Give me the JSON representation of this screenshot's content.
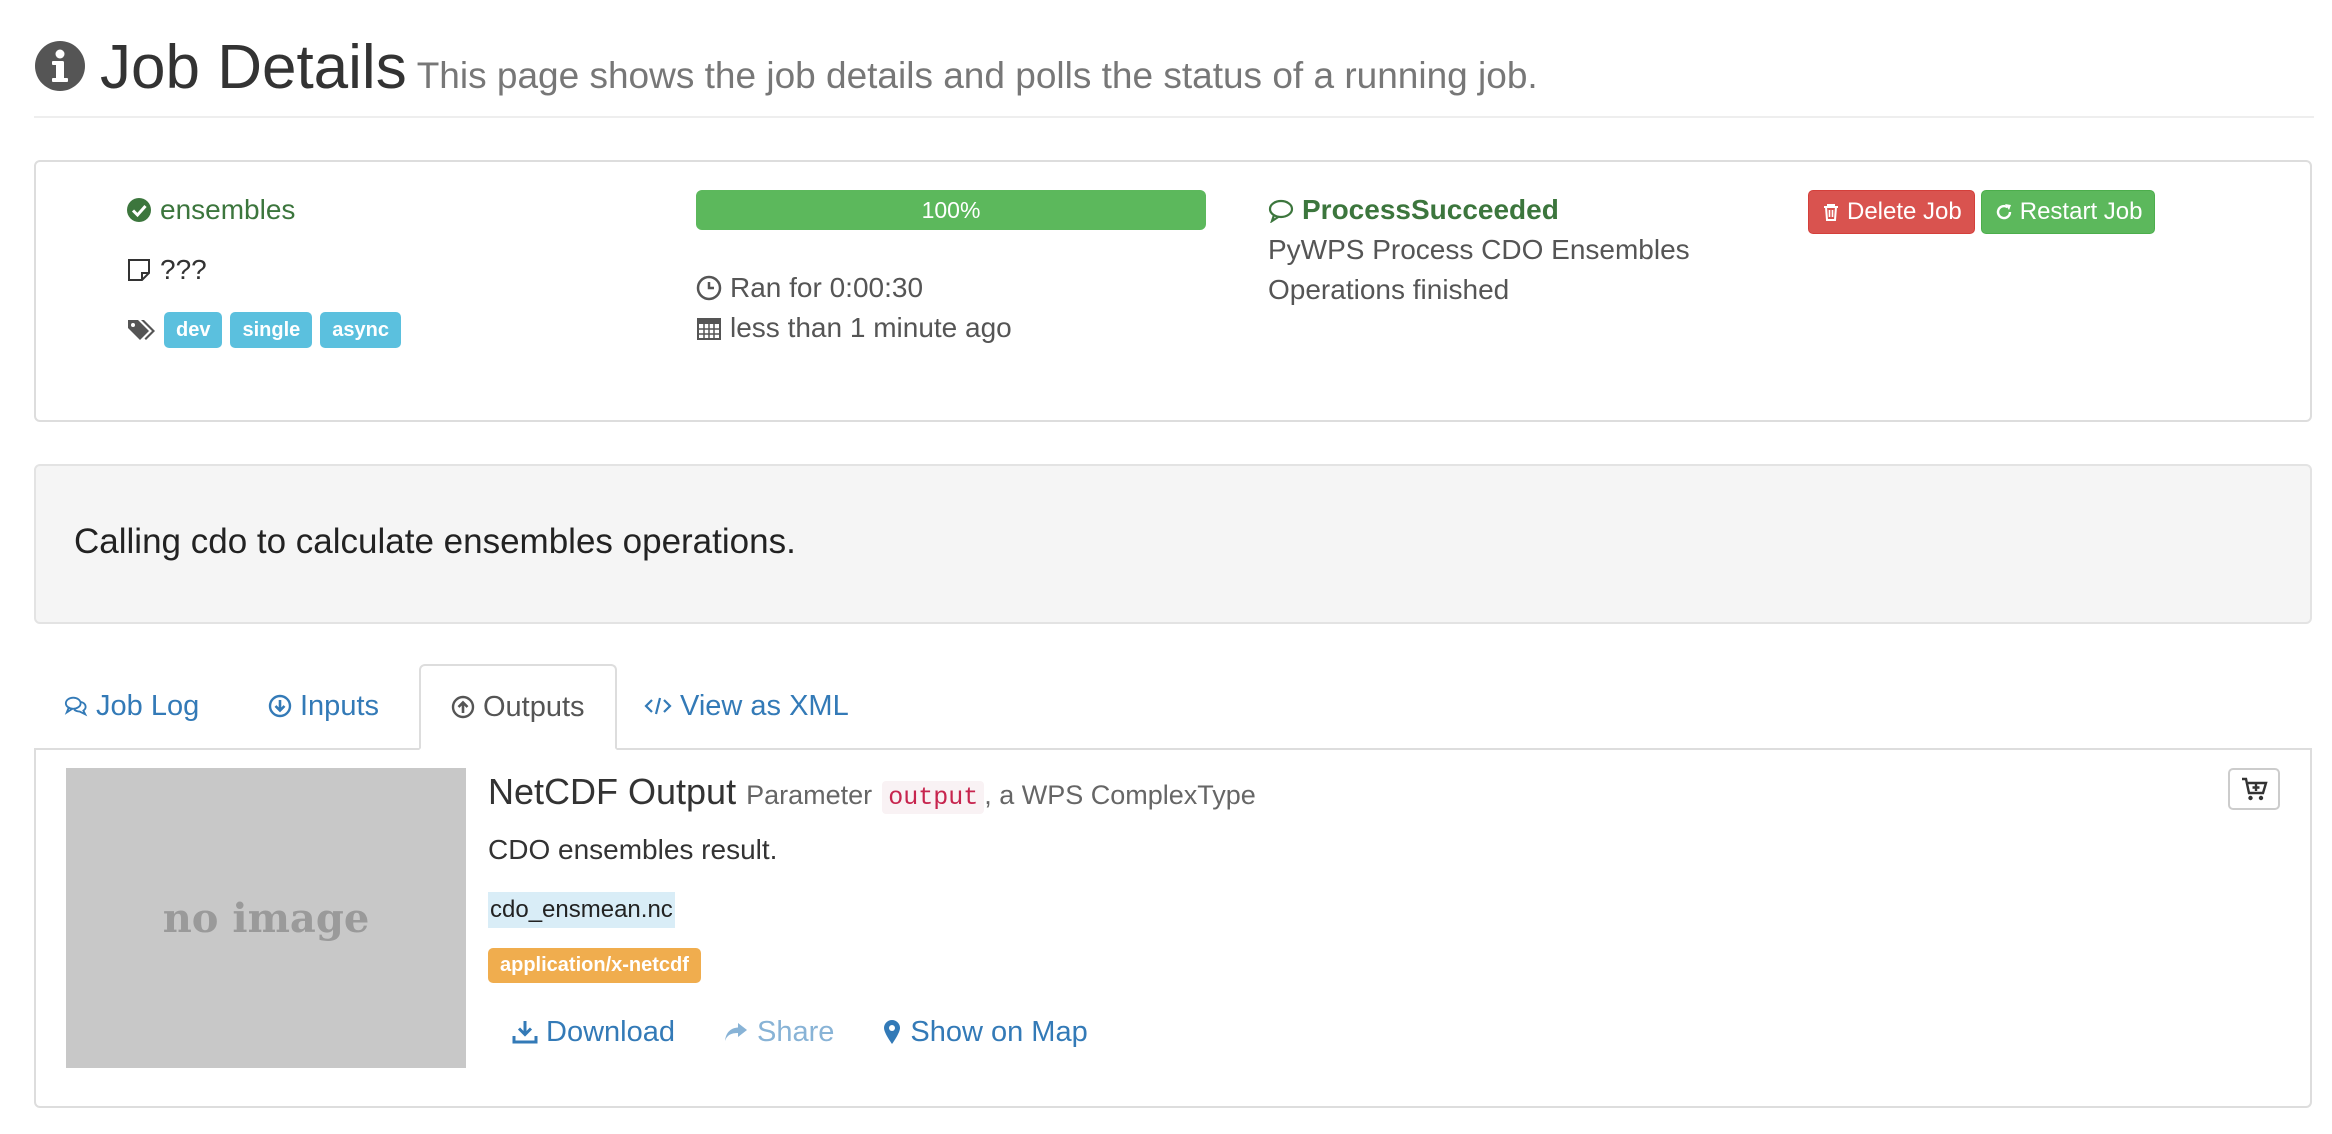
{
  "header": {
    "title": "Job Details",
    "subtitle": "This page shows the job details and polls the status of a running job."
  },
  "job": {
    "title": "ensembles",
    "abstract": "???",
    "tags": [
      "dev",
      "single",
      "async"
    ],
    "progress_label": "100%",
    "progress_fraction": 1.0,
    "duration": "Ran for 0:00:30",
    "created": "less than 1 minute ago",
    "status": "ProcessSucceeded",
    "status_message_line1": "PyWPS Process CDO Ensembles",
    "status_message_line2": "Operations finished",
    "delete_label": "Delete Job",
    "restart_label": "Restart Job"
  },
  "process": {
    "abstract": "Calling cdo to calculate ensembles operations."
  },
  "tabs": [
    {
      "label": "Job Log",
      "icon": "comments-icon"
    },
    {
      "label": "Inputs",
      "icon": "arrow-circle-down-icon"
    },
    {
      "label": "Outputs",
      "icon": "arrow-circle-up-icon",
      "active": true
    },
    {
      "label": "View as XML",
      "icon": "code-icon"
    }
  ],
  "output": {
    "thumbnail_text": "no image",
    "title": "NetCDF Output",
    "param_prefix": "Parameter",
    "identifier": "output",
    "param_suffix": ", a WPS ComplexType",
    "abstract": "CDO ensembles result.",
    "filename": "cdo_ensmean.nc",
    "mime_type": "application/x-netcdf",
    "actions": {
      "download": "Download",
      "share": "Share",
      "map": "Show on Map"
    }
  },
  "colors": {
    "success": "#5cb85c",
    "danger": "#d9534f",
    "info": "#5bc0de",
    "warning": "#f0ad4e",
    "link": "#337ab7"
  }
}
